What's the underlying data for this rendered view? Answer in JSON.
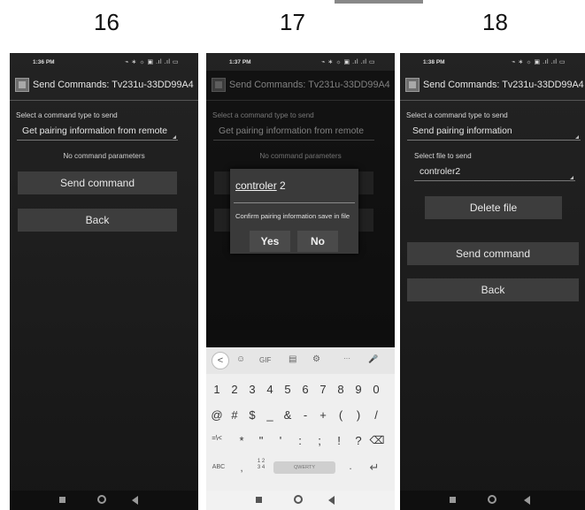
{
  "step_numbers": [
    "16",
    "17",
    "18"
  ],
  "phone16": {
    "time": "1:36 PM",
    "status_icons": "⌁ ∗ ☼ ▣ .ıl .ıl ▭",
    "title": "Send Commands: Tv231u-33DD99A4",
    "command_type_label": "Select a command type to send",
    "command_type_value": "Get pairing information from remote",
    "params_note": "No command parameters",
    "send_label": "Send command",
    "back_label": "Back"
  },
  "phone17": {
    "time": "1:37 PM",
    "status_icons": "⌁ ∗ ☼ ▣ .ıl .ıl ▭",
    "title": "Send Commands: Tv231u-33DD99A4",
    "command_type_label": "Select a command type to send",
    "command_type_value": "Get pairing information from remote",
    "params_note": "No command parameters",
    "dialog": {
      "input_value": "controler",
      "input_suffix": " 2",
      "message": "Confirm pairing information save in file",
      "yes_label": "Yes",
      "no_label": "No"
    },
    "keyboard": {
      "tools": [
        "☺",
        "GIF",
        "▤",
        "⚙",
        "···",
        "🎤"
      ],
      "back_key": "<",
      "row1": [
        "1",
        "2",
        "3",
        "4",
        "5",
        "6",
        "7",
        "8",
        "9",
        "0"
      ],
      "row2": [
        "@",
        "#",
        "$",
        "_",
        "&",
        "-",
        "+",
        "(",
        ")",
        "/"
      ],
      "row3": [
        "=\\<",
        "*",
        "\"",
        "'",
        ":",
        ";",
        "!",
        "?",
        "⌫"
      ],
      "abc": "ABC",
      "comma": ",",
      "numpad": "1 2\n3 4",
      "space": "QWERTY",
      "period": ".",
      "enter": "↵"
    }
  },
  "phone18": {
    "time": "1:38 PM",
    "status_icons": "⌁ ∗ ☼ ▣ .ıl .ıl ▭",
    "title": "Send Commands: Tv231u-33DD99A4",
    "command_type_label": "Select a command type to send",
    "command_type_value": "Send pairing information",
    "file_label": "Select file to send",
    "file_value": "controler2",
    "delete_label": "Delete file",
    "send_label": "Send command",
    "back_label": "Back"
  }
}
